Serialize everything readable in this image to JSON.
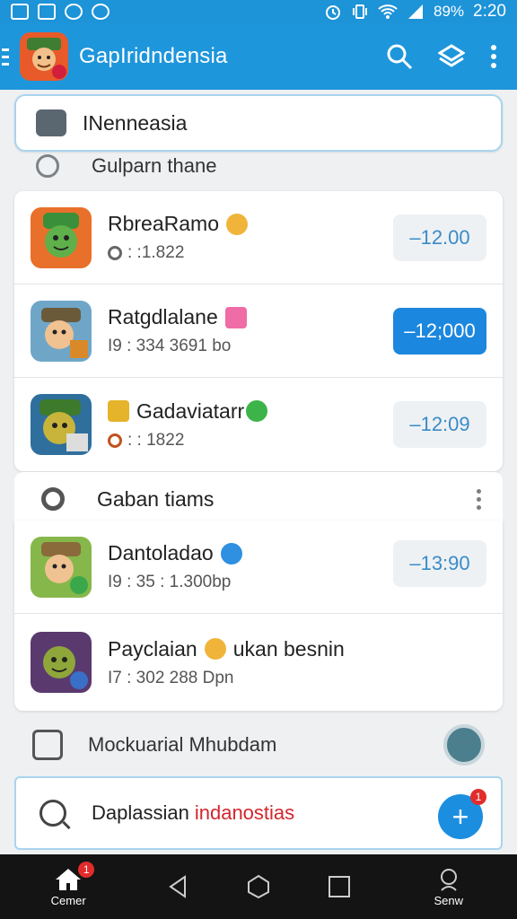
{
  "status_bar": {
    "battery": "89%",
    "time": "2:20"
  },
  "app_bar": {
    "title": "GapIridndensia"
  },
  "search": {
    "value": "INenneasia"
  },
  "section1": {
    "label": "Gulparn thane"
  },
  "list1": [
    {
      "name": "RbreaRamo",
      "meta": ": :1.822",
      "price": "–12.00",
      "active": false
    },
    {
      "name": "Ratgdlalane",
      "meta": "I9 : 334  3691 bo",
      "price": "–12;000",
      "active": true
    },
    {
      "name": "Gadaviatarr",
      "meta": ": : 1822",
      "price": "–12:09",
      "active": false
    }
  ],
  "group2": {
    "title": "Gaban tiams"
  },
  "list2": [
    {
      "name": "Dantoladao",
      "meta": "I9 : 35 :  1.300bp",
      "price": "–13:90"
    },
    {
      "name": "Payclaian",
      "name_suffix": "ukan besnin",
      "meta": "I7 : 302  288 Dpn"
    }
  ],
  "footer_row": {
    "label": "Mockuarial Mhubdam"
  },
  "bottom_search": {
    "text": "Daplassian",
    "highlight": "indanostias",
    "badge": "1"
  },
  "nav": {
    "home_label": "Cemer",
    "home_badge": "1",
    "profile_label": "Senw"
  },
  "colors": {
    "primary": "#1e96db",
    "active_button": "#1c87de",
    "highlight": "#d2272d"
  }
}
